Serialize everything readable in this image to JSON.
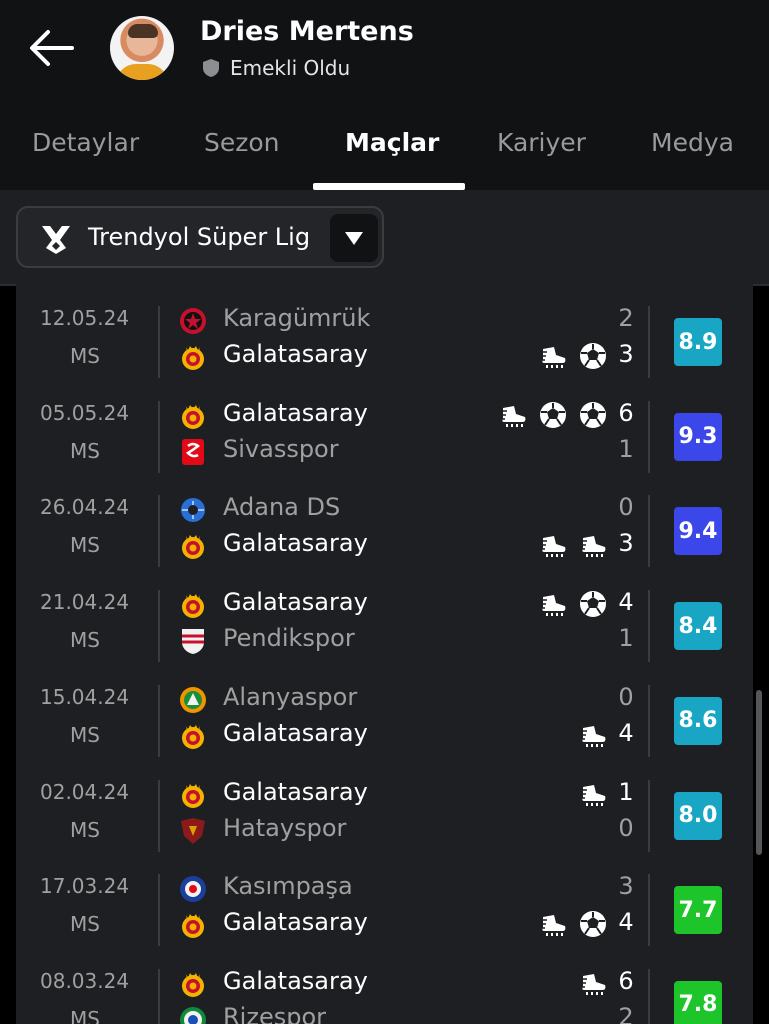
{
  "header": {
    "back_icon": "arrow-left-icon",
    "player_name": "Dries Mertens",
    "player_status": "Emekli Oldu",
    "status_icon": "shield-icon"
  },
  "tabs": [
    {
      "label": "Detaylar",
      "active": false
    },
    {
      "label": "Sezon",
      "active": false
    },
    {
      "label": "Maçlar",
      "active": true
    },
    {
      "label": "Kariyer",
      "active": false
    },
    {
      "label": "Medya",
      "active": false
    }
  ],
  "filter": {
    "league": "Trendyol Süper Lig",
    "caret_icon": "caret-down-icon"
  },
  "colors": {
    "rating_cyan": "#19a6c4",
    "rating_blue": "#3b47e8",
    "rating_green": "#1ec52a"
  },
  "matches": [
    {
      "date": "12.05.24",
      "status": "MS",
      "home": {
        "name": "Karagümrük",
        "score": "2",
        "result": "lose",
        "events": []
      },
      "away": {
        "name": "Galatasaray",
        "score": "3",
        "result": "win",
        "events": [
          "assist-boot-icon",
          "goal-ball-icon"
        ]
      },
      "rating": "8.9",
      "rating_color": "#19a6c4"
    },
    {
      "date": "05.05.24",
      "status": "MS",
      "home": {
        "name": "Galatasaray",
        "score": "6",
        "result": "win",
        "events": [
          "assist-boot-icon",
          "goal-ball-icon",
          "goal-ball-icon"
        ]
      },
      "away": {
        "name": "Sivasspor",
        "score": "1",
        "result": "lose",
        "events": []
      },
      "rating": "9.3",
      "rating_color": "#3b47e8"
    },
    {
      "date": "26.04.24",
      "status": "MS",
      "home": {
        "name": "Adana DS",
        "score": "0",
        "result": "lose",
        "events": []
      },
      "away": {
        "name": "Galatasaray",
        "score": "3",
        "result": "win",
        "events": [
          "assist-boot-icon",
          "assist-boot-icon"
        ]
      },
      "rating": "9.4",
      "rating_color": "#3b47e8"
    },
    {
      "date": "21.04.24",
      "status": "MS",
      "home": {
        "name": "Galatasaray",
        "score": "4",
        "result": "win",
        "events": [
          "assist-boot-icon",
          "goal-ball-icon"
        ]
      },
      "away": {
        "name": "Pendikspor",
        "score": "1",
        "result": "lose",
        "events": []
      },
      "rating": "8.4",
      "rating_color": "#19a6c4"
    },
    {
      "date": "15.04.24",
      "status": "MS",
      "home": {
        "name": "Alanyaspor",
        "score": "0",
        "result": "lose",
        "events": []
      },
      "away": {
        "name": "Galatasaray",
        "score": "4",
        "result": "win",
        "events": [
          "assist-boot-icon"
        ]
      },
      "rating": "8.6",
      "rating_color": "#19a6c4"
    },
    {
      "date": "02.04.24",
      "status": "MS",
      "home": {
        "name": "Galatasaray",
        "score": "1",
        "result": "win",
        "events": [
          "assist-boot-icon"
        ]
      },
      "away": {
        "name": "Hatayspor",
        "score": "0",
        "result": "lose",
        "events": []
      },
      "rating": "8.0",
      "rating_color": "#19a6c4"
    },
    {
      "date": "17.03.24",
      "status": "MS",
      "home": {
        "name": "Kasımpaşa",
        "score": "3",
        "result": "lose",
        "events": []
      },
      "away": {
        "name": "Galatasaray",
        "score": "4",
        "result": "win",
        "events": [
          "assist-boot-icon",
          "goal-ball-icon"
        ]
      },
      "rating": "7.7",
      "rating_color": "#1ec52a"
    },
    {
      "date": "08.03.24",
      "status": "MS",
      "home": {
        "name": "Galatasaray",
        "score": "6",
        "result": "win",
        "events": [
          "assist-boot-icon"
        ]
      },
      "away": {
        "name": "Rizespor",
        "score": "2",
        "result": "lose",
        "events": []
      },
      "rating": "7.8",
      "rating_color": "#1ec52a"
    }
  ]
}
